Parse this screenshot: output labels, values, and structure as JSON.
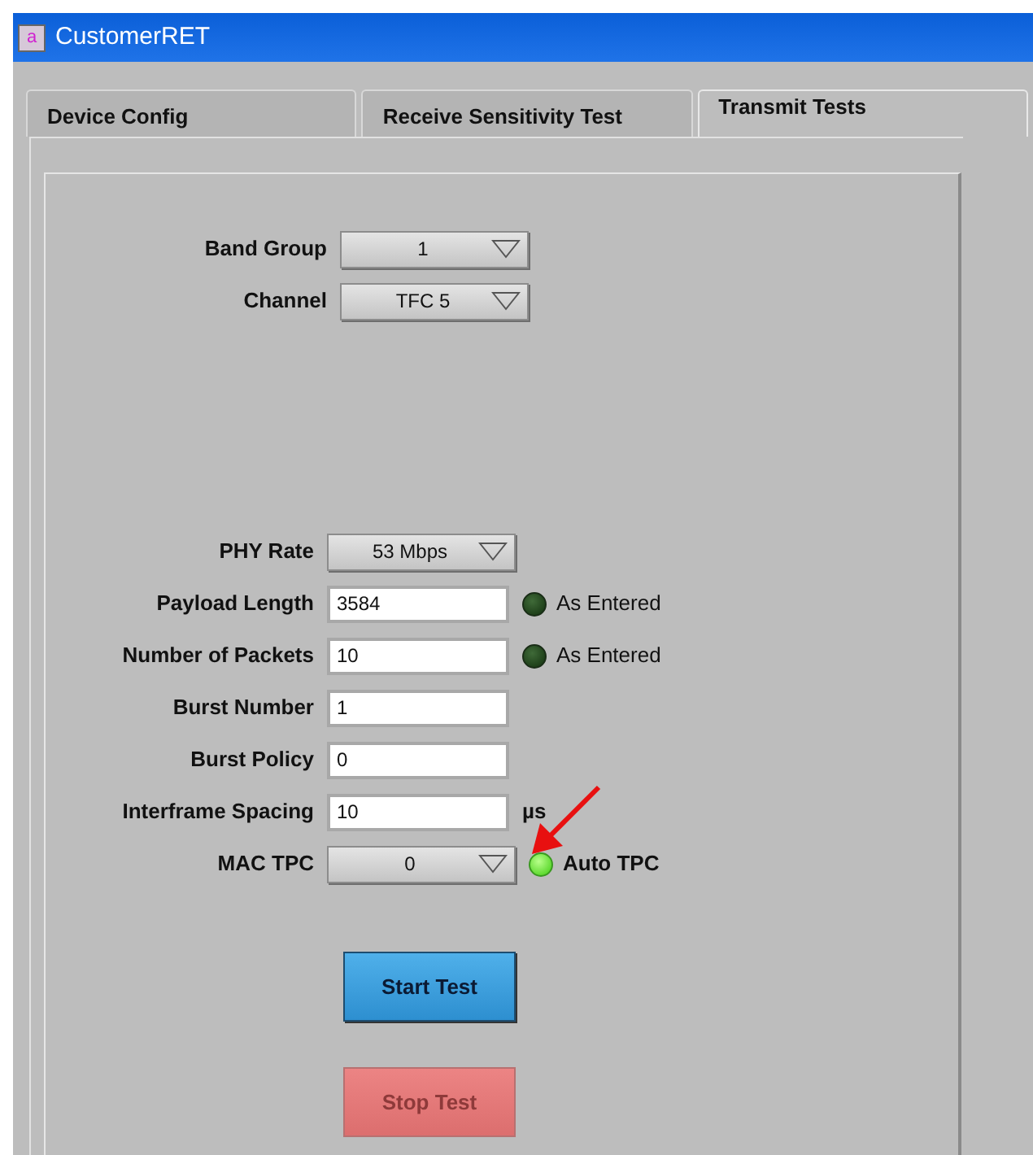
{
  "window": {
    "title": "CustomerRET",
    "icon_letter": "a"
  },
  "tabs": [
    {
      "label": "Device Config",
      "selected": false
    },
    {
      "label": "Receive Sensitivity Test",
      "selected": false
    },
    {
      "label": "Transmit Tests",
      "selected": true
    }
  ],
  "band_controls": [
    {
      "kind": "dropdown",
      "label": "Band Group",
      "value": "1"
    },
    {
      "kind": "dropdown",
      "label": "Channel",
      "value": "TFC 5"
    }
  ],
  "transmit_controls": [
    {
      "kind": "dropdown",
      "label": "PHY Rate",
      "value": "53 Mbps"
    },
    {
      "kind": "text",
      "label": "Payload Length",
      "value": "3584",
      "indicator": {
        "on": false,
        "label": "As Entered"
      }
    },
    {
      "kind": "text",
      "label": "Number of Packets",
      "value": "10",
      "indicator": {
        "on": false,
        "label": "As Entered"
      }
    },
    {
      "kind": "text",
      "label": "Burst Number",
      "value": "1"
    },
    {
      "kind": "text",
      "label": "Burst Policy",
      "value": "0"
    },
    {
      "kind": "text",
      "label": "Interframe Spacing",
      "value": "10",
      "unit": "µs"
    },
    {
      "kind": "dropdown",
      "label": "MAC TPC",
      "value": "0",
      "indicator": {
        "on": true,
        "label": "Auto TPC"
      }
    }
  ],
  "buttons": [
    {
      "kind": "start",
      "label": "Start Test",
      "disabled": false
    },
    {
      "kind": "stop",
      "label": "Stop Test",
      "disabled": true
    }
  ]
}
